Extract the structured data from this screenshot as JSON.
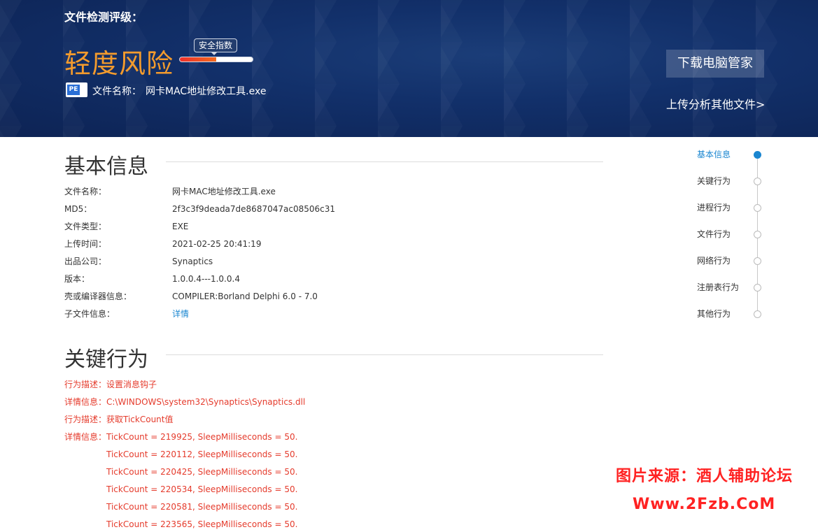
{
  "header": {
    "grade_label": "文件检测评级：",
    "risk_level": "轻度风险",
    "index_badge": "安全指数",
    "index_value": 0.5,
    "file_icon_text": "PE",
    "file_name_label": "文件名称：",
    "file_name": "网卡MAC地址修改工具.exe",
    "download_button": "下载电脑管家",
    "upload_link": "上传分析其他文件>"
  },
  "basic_info": {
    "title": "基本信息",
    "rows": [
      {
        "key": "文件名称：",
        "value": "网卡MAC地址修改工具.exe"
      },
      {
        "key": "MD5：",
        "value": "2f3c3f9deada7de8687047ac08506c31"
      },
      {
        "key": "文件类型：",
        "value": "EXE"
      },
      {
        "key": "上传时间：",
        "value": "2021-02-25 20:41:19"
      },
      {
        "key": "出品公司：",
        "value": "Synaptics"
      },
      {
        "key": "版本：",
        "value": "1.0.0.4---1.0.0.4"
      },
      {
        "key": "壳或编译器信息：",
        "value": "COMPILER:Borland Delphi 6.0 - 7.0"
      },
      {
        "key": "子文件信息：",
        "value": "详情"
      }
    ]
  },
  "key_behavior": {
    "title": "关键行为",
    "rows": [
      {
        "label": "行为描述：",
        "value": "设置消息钩子"
      },
      {
        "label": "详情信息：",
        "value": "C:\\WINDOWS\\system32\\Synaptics\\Synaptics.dll"
      },
      {
        "label": "行为描述：",
        "value": "获取TickCount值"
      },
      {
        "label": "详情信息：",
        "value": "TickCount = 219925, SleepMilliseconds = 50."
      },
      {
        "label": "",
        "value": "TickCount = 220112, SleepMilliseconds = 50."
      },
      {
        "label": "",
        "value": "TickCount = 220425, SleepMilliseconds = 50."
      },
      {
        "label": "",
        "value": "TickCount = 220534, SleepMilliseconds = 50."
      },
      {
        "label": "",
        "value": "TickCount = 220581, SleepMilliseconds = 50."
      },
      {
        "label": "",
        "value": "TickCount = 223565, SleepMilliseconds = 50."
      }
    ]
  },
  "nav": {
    "items": [
      "基本信息",
      "关键行为",
      "进程行为",
      "文件行为",
      "网络行为",
      "注册表行为",
      "其他行为"
    ],
    "active": 0
  },
  "watermark": {
    "line1": "图片来源：酒人辅助论坛",
    "line2": "Www.2Fzb.CoM"
  },
  "colors": {
    "risk": "#f39b2d",
    "behavior_text": "#e53b2c",
    "link": "#1a86d0",
    "banner": "#12306a"
  }
}
